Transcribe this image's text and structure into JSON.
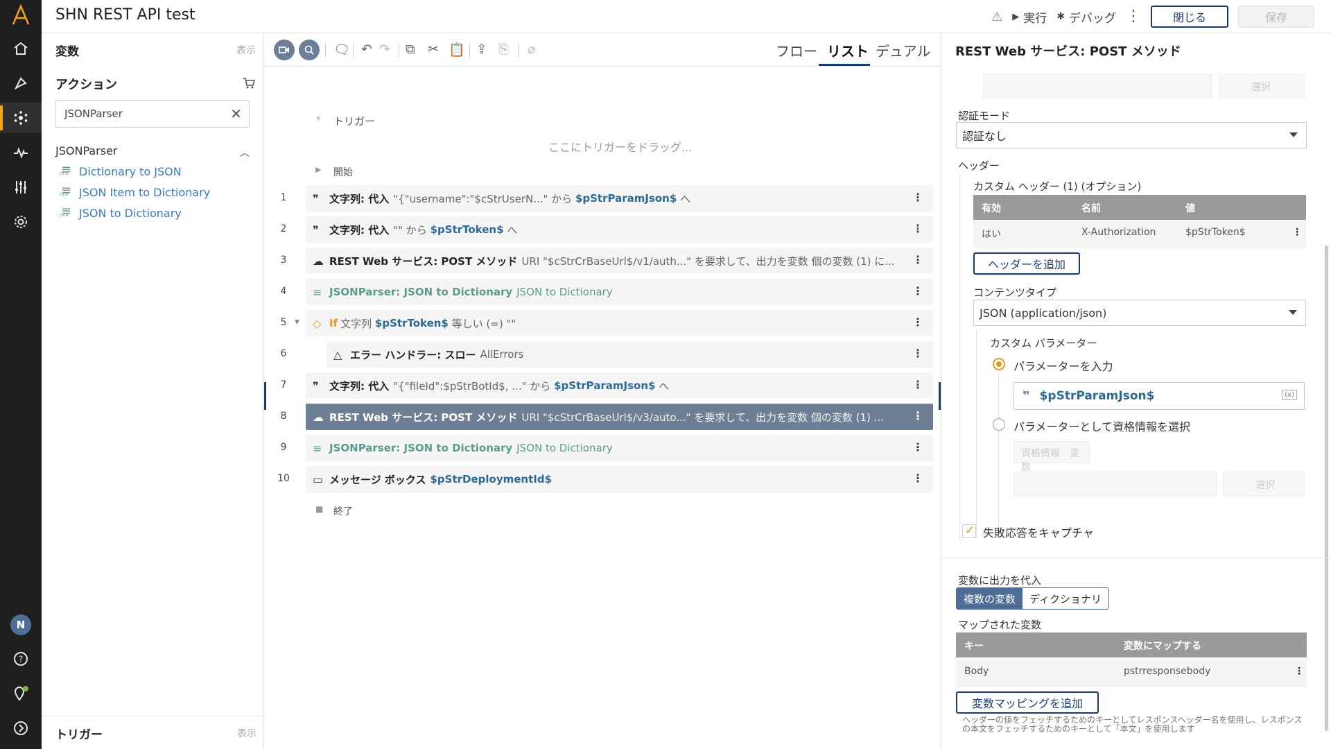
{
  "app": {
    "title": "SHN REST API test"
  },
  "topbar": {
    "run_label": "実行",
    "debug_label": "デバッグ",
    "close_label": "閉じる",
    "save_label": "保存"
  },
  "left_panel": {
    "variables_title": "変数",
    "variables_show": "表示",
    "actions_title": "アクション",
    "search_value": "JSONParser",
    "group_label": "JSONParser",
    "items": [
      {
        "label": "Dictionary to JSON"
      },
      {
        "label": "JSON Item to Dictionary"
      },
      {
        "label": "JSON to Dictionary"
      }
    ],
    "triggers_title": "トリガー",
    "triggers_show": "表示"
  },
  "center": {
    "tabs": [
      "フロー",
      "リスト",
      "デュアル"
    ],
    "active_tab": "リスト",
    "trigger_label": "トリガー",
    "trigger_drop": "ここにトリガーをドラッグ...",
    "start_label": "開始",
    "end_label": "終了",
    "rows": [
      {
        "num": "1",
        "name": "文字列: 代入",
        "desc1": "\"{\"username\":\"$cStrUserN...\" から",
        "var": "$pStrParamJson$",
        "desc2": "へ"
      },
      {
        "num": "2",
        "name": "文字列: 代入",
        "desc1": "\"\" から",
        "var": "$pStrToken$",
        "desc2": "へ"
      },
      {
        "num": "3",
        "name": "REST Web サービス: POST メソッド",
        "desc1": "URI \"$cStrCrBaseUrl$/v1/auth...\" を要求して、出力を変数 個の変数 (1) に..."
      },
      {
        "num": "4",
        "name": "JSONParser: JSON to Dictionary",
        "desc1": "JSON to Dictionary"
      },
      {
        "num": "5",
        "keyword": "If",
        "desc1": "文字列",
        "var": "$pStrToken$",
        "desc2": "等しい (=) \"\""
      },
      {
        "num": "6",
        "name": "エラー ハンドラー: スロー",
        "desc1": "AllErrors"
      },
      {
        "num": "7",
        "name": "文字列: 代入",
        "desc1": "\"{\"fileId\":$pStrBotId$, ...\" から",
        "var": "$pStrParamJson$",
        "desc2": "へ"
      },
      {
        "num": "8",
        "name": "REST Web サービス: POST メソッド",
        "desc1": "URI \"$cStrCrBaseUrl$/v3/auto...\" を要求して、出力を変数 個の変数 (1) ..."
      },
      {
        "num": "9",
        "name": "JSONParser: JSON to Dictionary",
        "desc1": "JSON to Dictionary"
      },
      {
        "num": "10",
        "name": "メッセージ ボックス",
        "var": "$pStrDeploymentId$"
      }
    ]
  },
  "right_panel": {
    "title": "REST Web サービス: POST メソッド",
    "auth_label": "認証モード",
    "auth_value": "認証なし",
    "headers_label": "ヘッダー",
    "custom_headers_label": "カスタム ヘッダー (1) (オプション)",
    "header_columns": [
      "有効",
      "名前",
      "値"
    ],
    "header_row": [
      "はい",
      "X-Authorization",
      "$pStrToken$"
    ],
    "add_header_label": "ヘッダーを追加",
    "content_type_label": "コンテンツタイプ",
    "content_type_value": "JSON (application/json)",
    "custom_params_label": "カスタム パラメーター",
    "radio_enter_label": "パラメーターを入力",
    "param_value": "$pStrParamJson$",
    "fx_label": "(x)",
    "radio_credential_label": "パラメーターとして資格情報を選択",
    "credential_tab": "資格情報",
    "variable_tab": "変数",
    "select_label": "選択",
    "capture_failure_label": "失敗応答をキャプチャ",
    "assign_output_label": "変数に出力を代入",
    "seg_multi": "複数の変数",
    "seg_dict": "ディクショナリ",
    "mapped_label": "マップされた変数",
    "map_columns": [
      "キー",
      "変数にマップする"
    ],
    "map_row": [
      "Body",
      "pstrresponsebody"
    ],
    "add_mapping_label": "変数マッピングを追加",
    "hint": "ヘッダーの値をフェッチするためのキーとしてレスポンスヘッダー名を使用し、レスポンスの本文をフェッチするためのキーとして「本文」を使用します"
  },
  "colors": {
    "accent": "#f1a21b",
    "primary": "#1b3b6f",
    "selected_row": "#6e7f93",
    "var": "#2d6a96"
  }
}
